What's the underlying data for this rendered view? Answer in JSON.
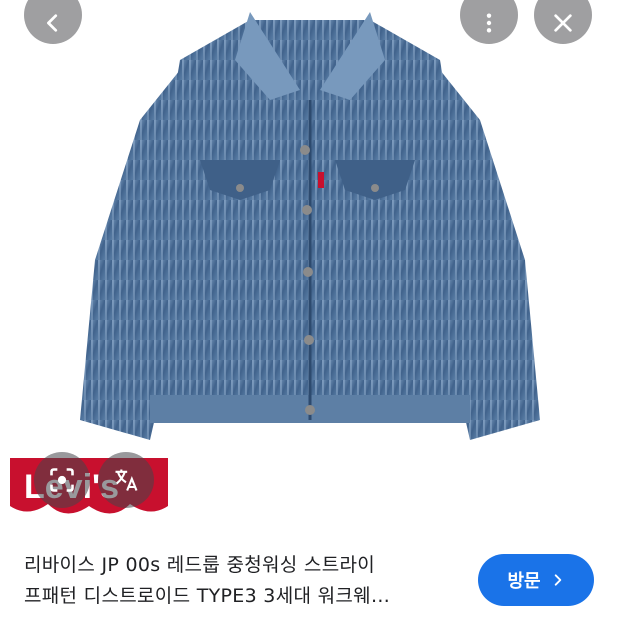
{
  "toolbar": {
    "back_icon": "chevron-left-icon",
    "more_icon": "more-vert-icon",
    "close_icon": "close-icon"
  },
  "overlay": {
    "search_icon": "lens-search-icon",
    "translate_icon": "translate-icon"
  },
  "product": {
    "logo_text": "Levi's",
    "title_line1": "리바이스 JP 00s 레드룹 중청워싱 스트라이",
    "title_line2": "프패턴 디스트로이드 TYPE3 3세대 워크웨…"
  },
  "visit_button": {
    "label": "방문",
    "icon": "chevron-right-icon"
  },
  "colors": {
    "accent": "#1a73e8",
    "denim": "#4a6f97",
    "logo_red": "#c8102e"
  }
}
